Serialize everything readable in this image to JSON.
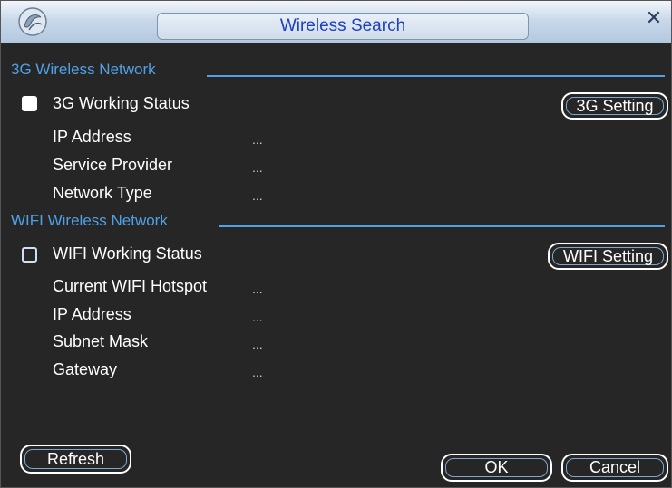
{
  "window": {
    "title": "Wireless Search",
    "logo_icon": "shell-logo-icon",
    "close_icon": "close-icon"
  },
  "wireless_3g": {
    "section_title": "3G Wireless Network",
    "working_status_label": "3G Working Status",
    "working_status_checked": true,
    "setting_button": "3G Setting",
    "fields": [
      {
        "label": "IP Address",
        "value": "..."
      },
      {
        "label": "Service Provider",
        "value": "..."
      },
      {
        "label": "Network Type",
        "value": "..."
      }
    ]
  },
  "wifi": {
    "section_title": "WIFI Wireless Network",
    "working_status_label": "WIFI Working Status",
    "working_status_checked": false,
    "setting_button": "WIFI Setting",
    "fields": [
      {
        "label": "Current WIFI Hotspot",
        "value": "..."
      },
      {
        "label": "IP Address",
        "value": "..."
      },
      {
        "label": "Subnet Mask",
        "value": "..."
      },
      {
        "label": "Gateway",
        "value": "..."
      }
    ]
  },
  "buttons": {
    "refresh": "Refresh",
    "ok": "OK",
    "cancel": "Cancel"
  },
  "colors": {
    "background": "#262626",
    "accent": "#4fa0e6",
    "title_text": "#1e3fc4"
  }
}
